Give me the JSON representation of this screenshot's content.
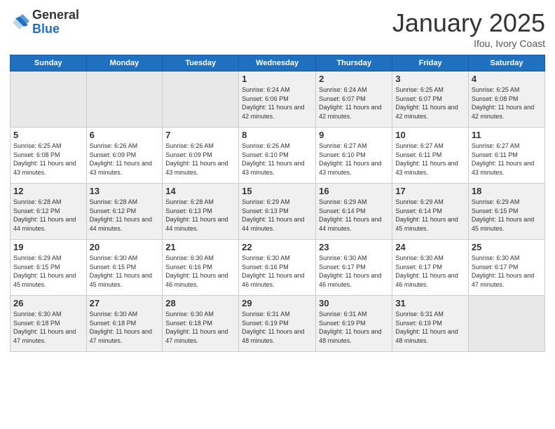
{
  "logo": {
    "line1": "General",
    "line2": "Blue"
  },
  "title": {
    "month": "January 2025",
    "location": "Ifou, Ivory Coast"
  },
  "weekdays": [
    "Sunday",
    "Monday",
    "Tuesday",
    "Wednesday",
    "Thursday",
    "Friday",
    "Saturday"
  ],
  "weeks": [
    [
      {
        "day": "",
        "empty": true
      },
      {
        "day": "",
        "empty": true
      },
      {
        "day": "",
        "empty": true
      },
      {
        "day": "1",
        "sunrise": "6:24 AM",
        "sunset": "6:06 PM",
        "daylight": "11 hours and 42 minutes."
      },
      {
        "day": "2",
        "sunrise": "6:24 AM",
        "sunset": "6:07 PM",
        "daylight": "11 hours and 42 minutes."
      },
      {
        "day": "3",
        "sunrise": "6:25 AM",
        "sunset": "6:07 PM",
        "daylight": "11 hours and 42 minutes."
      },
      {
        "day": "4",
        "sunrise": "6:25 AM",
        "sunset": "6:08 PM",
        "daylight": "11 hours and 42 minutes."
      }
    ],
    [
      {
        "day": "5",
        "sunrise": "6:25 AM",
        "sunset": "6:08 PM",
        "daylight": "11 hours and 43 minutes."
      },
      {
        "day": "6",
        "sunrise": "6:26 AM",
        "sunset": "6:09 PM",
        "daylight": "11 hours and 43 minutes."
      },
      {
        "day": "7",
        "sunrise": "6:26 AM",
        "sunset": "6:09 PM",
        "daylight": "11 hours and 43 minutes."
      },
      {
        "day": "8",
        "sunrise": "6:26 AM",
        "sunset": "6:10 PM",
        "daylight": "11 hours and 43 minutes."
      },
      {
        "day": "9",
        "sunrise": "6:27 AM",
        "sunset": "6:10 PM",
        "daylight": "11 hours and 43 minutes."
      },
      {
        "day": "10",
        "sunrise": "6:27 AM",
        "sunset": "6:11 PM",
        "daylight": "11 hours and 43 minutes."
      },
      {
        "day": "11",
        "sunrise": "6:27 AM",
        "sunset": "6:11 PM",
        "daylight": "11 hours and 43 minutes."
      }
    ],
    [
      {
        "day": "12",
        "sunrise": "6:28 AM",
        "sunset": "6:12 PM",
        "daylight": "11 hours and 44 minutes."
      },
      {
        "day": "13",
        "sunrise": "6:28 AM",
        "sunset": "6:12 PM",
        "daylight": "11 hours and 44 minutes."
      },
      {
        "day": "14",
        "sunrise": "6:28 AM",
        "sunset": "6:13 PM",
        "daylight": "11 hours and 44 minutes."
      },
      {
        "day": "15",
        "sunrise": "6:29 AM",
        "sunset": "6:13 PM",
        "daylight": "11 hours and 44 minutes."
      },
      {
        "day": "16",
        "sunrise": "6:29 AM",
        "sunset": "6:14 PM",
        "daylight": "11 hours and 44 minutes."
      },
      {
        "day": "17",
        "sunrise": "6:29 AM",
        "sunset": "6:14 PM",
        "daylight": "11 hours and 45 minutes."
      },
      {
        "day": "18",
        "sunrise": "6:29 AM",
        "sunset": "6:15 PM",
        "daylight": "11 hours and 45 minutes."
      }
    ],
    [
      {
        "day": "19",
        "sunrise": "6:29 AM",
        "sunset": "6:15 PM",
        "daylight": "11 hours and 45 minutes."
      },
      {
        "day": "20",
        "sunrise": "6:30 AM",
        "sunset": "6:15 PM",
        "daylight": "11 hours and 45 minutes."
      },
      {
        "day": "21",
        "sunrise": "6:30 AM",
        "sunset": "6:16 PM",
        "daylight": "11 hours and 46 minutes."
      },
      {
        "day": "22",
        "sunrise": "6:30 AM",
        "sunset": "6:16 PM",
        "daylight": "11 hours and 46 minutes."
      },
      {
        "day": "23",
        "sunrise": "6:30 AM",
        "sunset": "6:17 PM",
        "daylight": "11 hours and 46 minutes."
      },
      {
        "day": "24",
        "sunrise": "6:30 AM",
        "sunset": "6:17 PM",
        "daylight": "11 hours and 46 minutes."
      },
      {
        "day": "25",
        "sunrise": "6:30 AM",
        "sunset": "6:17 PM",
        "daylight": "11 hours and 47 minutes."
      }
    ],
    [
      {
        "day": "26",
        "sunrise": "6:30 AM",
        "sunset": "6:18 PM",
        "daylight": "11 hours and 47 minutes."
      },
      {
        "day": "27",
        "sunrise": "6:30 AM",
        "sunset": "6:18 PM",
        "daylight": "11 hours and 47 minutes."
      },
      {
        "day": "28",
        "sunrise": "6:30 AM",
        "sunset": "6:18 PM",
        "daylight": "11 hours and 47 minutes."
      },
      {
        "day": "29",
        "sunrise": "6:31 AM",
        "sunset": "6:19 PM",
        "daylight": "11 hours and 48 minutes."
      },
      {
        "day": "30",
        "sunrise": "6:31 AM",
        "sunset": "6:19 PM",
        "daylight": "11 hours and 48 minutes."
      },
      {
        "day": "31",
        "sunrise": "6:31 AM",
        "sunset": "6:19 PM",
        "daylight": "11 hours and 48 minutes."
      },
      {
        "day": "",
        "empty": true
      }
    ]
  ],
  "labels": {
    "sunrise": "Sunrise:",
    "sunset": "Sunset:",
    "daylight": "Daylight:"
  }
}
